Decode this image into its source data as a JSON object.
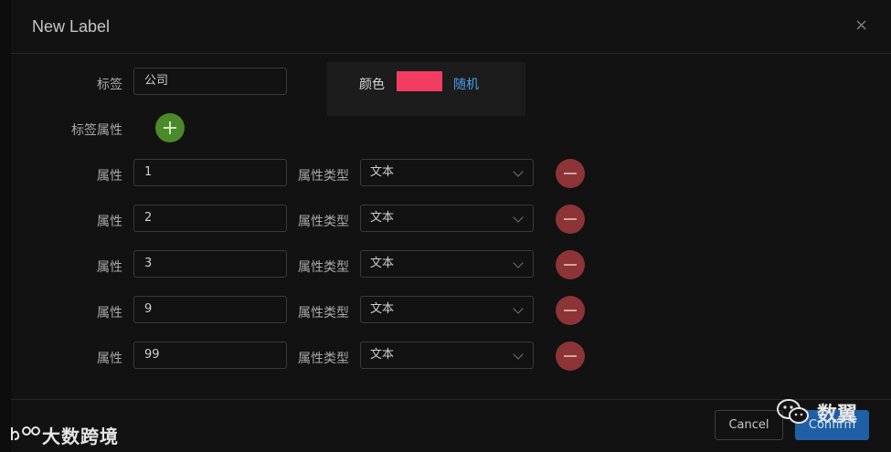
{
  "dialog": {
    "title": "New Label",
    "close_glyph": "×"
  },
  "form": {
    "label_caption": "标签",
    "label_value": "公司",
    "color": {
      "caption": "颜色",
      "swatch_hex": "#f23d61",
      "random_label": "随机"
    },
    "attributes_caption": "标签属性",
    "rows": [
      {
        "attr_caption": "属性",
        "attr_value": "1",
        "type_caption": "属性类型",
        "type_value": "文本"
      },
      {
        "attr_caption": "属性",
        "attr_value": "2",
        "type_caption": "属性类型",
        "type_value": "文本"
      },
      {
        "attr_caption": "属性",
        "attr_value": "3",
        "type_caption": "属性类型",
        "type_value": "文本"
      },
      {
        "attr_caption": "属性",
        "attr_value": "9",
        "type_caption": "属性类型",
        "type_value": "文本"
      },
      {
        "attr_caption": "属性",
        "attr_value": "99",
        "type_caption": "属性类型",
        "type_value": "文本"
      }
    ]
  },
  "footer": {
    "cancel_label": "Cancel",
    "confirm_label": "Confirm"
  },
  "watermarks": {
    "left_text": "大数跨境",
    "right_text": "数翼"
  },
  "colors": {
    "add_button": "#4a8a28",
    "remove_button": "#8c3436",
    "link": "#4a9fee",
    "confirm": "#1f5fa3"
  }
}
